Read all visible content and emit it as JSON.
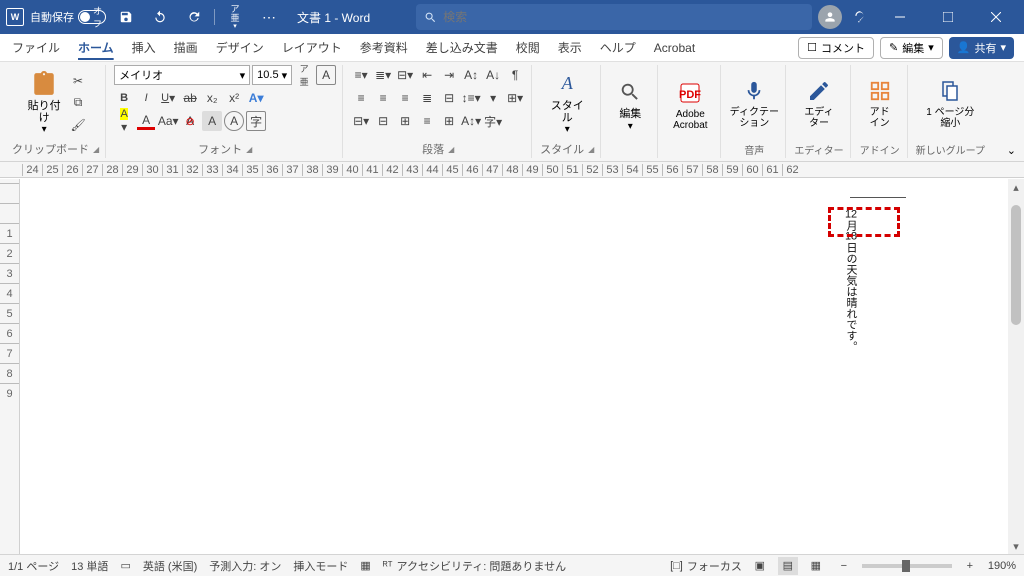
{
  "titlebar": {
    "autosave_label": "自動保存",
    "autosave_state": "オフ",
    "doc_title": "文書 1 - Word",
    "search_placeholder": "検索"
  },
  "tabs": [
    "ファイル",
    "ホーム",
    "挿入",
    "描画",
    "デザイン",
    "レイアウト",
    "参考資料",
    "差し込み文書",
    "校閲",
    "表示",
    "ヘルプ",
    "Acrobat"
  ],
  "active_tab": "ホーム",
  "right_pills": {
    "comment": "コメント",
    "editing": "編集",
    "share": "共有"
  },
  "ribbon": {
    "clipboard": {
      "paste": "貼り付け",
      "label": "クリップボード"
    },
    "font": {
      "name": "メイリオ",
      "size": "10.5",
      "label": "フォント"
    },
    "paragraph": {
      "label": "段落"
    },
    "styles": {
      "btn": "スタイル",
      "label": "スタイル"
    },
    "editing": {
      "btn": "編集"
    },
    "acrobat": {
      "btn": "Adobe\nAcrobat"
    },
    "dictation": {
      "btn": "ディクテー\nション",
      "label": "音声"
    },
    "editor": {
      "btn": "エディ\nター",
      "label": "エディター"
    },
    "addin": {
      "btn": "アド\nイン",
      "label": "アドイン"
    },
    "pagezoom": {
      "btn": "1 ページ分\n縮小",
      "label": "新しいグループ"
    }
  },
  "document": {
    "num1": "12",
    "rest": "月",
    "num2": "18",
    "rest2": "日の天気は晴れです。"
  },
  "statusbar": {
    "page": "1/1 ページ",
    "words": "13 単語",
    "lang": "英語 (米国)",
    "predict": "予測入力: オン",
    "insert": "挿入モード",
    "a11y": "アクセシビリティ: 問題ありません",
    "focus": "フォーカス",
    "zoom": "190%"
  },
  "ruler_h": [
    24,
    25,
    26,
    27,
    28,
    29,
    30,
    31,
    32,
    33,
    34,
    35,
    36,
    37,
    38,
    39,
    40,
    41,
    42,
    43,
    44,
    45,
    46,
    47,
    48,
    49,
    50,
    51,
    52,
    53,
    54,
    55,
    56,
    57,
    58,
    59,
    60,
    61,
    62
  ],
  "ruler_v": [
    "",
    "",
    "1",
    "2",
    "3",
    "4",
    "5",
    "6",
    "7",
    "8",
    "9"
  ]
}
